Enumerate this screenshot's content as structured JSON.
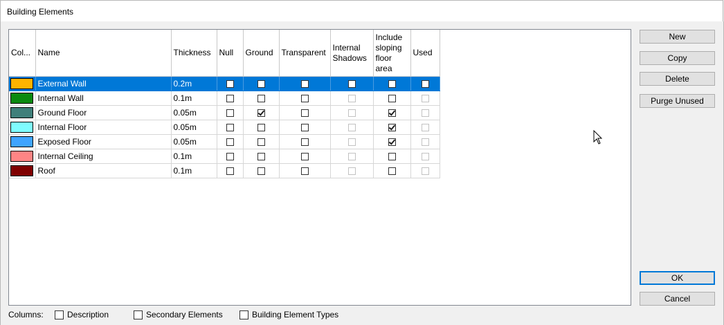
{
  "window": {
    "title": "Building Elements"
  },
  "table": {
    "headers": {
      "color": "Col...",
      "name": "Name",
      "thickness": "Thickness",
      "null": "Null",
      "ground": "Ground",
      "transparent": "Transparent",
      "internal_shadows": "Internal Shadows",
      "include_sloping": "Include sloping floor area",
      "used": "Used"
    },
    "rows": [
      {
        "color": "#ffb300",
        "name": "External Wall",
        "thickness": "0.2m",
        "null": false,
        "ground": false,
        "transparent": false,
        "internal_shadows": false,
        "include_sloping": false,
        "used": false,
        "selected": true
      },
      {
        "color": "#0a8a10",
        "name": "Internal Wall",
        "thickness": "0.1m",
        "null": false,
        "ground": false,
        "transparent": false,
        "internal_shadows": false,
        "include_sloping": false,
        "used": false,
        "selected": false
      },
      {
        "color": "#3f7f7a",
        "name": "Ground Floor",
        "thickness": "0.05m",
        "null": false,
        "ground": true,
        "transparent": false,
        "internal_shadows": false,
        "include_sloping": true,
        "used": false,
        "selected": false
      },
      {
        "color": "#7ffcff",
        "name": "Internal Floor",
        "thickness": "0.05m",
        "null": false,
        "ground": false,
        "transparent": false,
        "internal_shadows": false,
        "include_sloping": true,
        "used": false,
        "selected": false
      },
      {
        "color": "#3fa4ff",
        "name": "Exposed Floor",
        "thickness": "0.05m",
        "null": false,
        "ground": false,
        "transparent": false,
        "internal_shadows": false,
        "include_sloping": true,
        "used": false,
        "selected": false
      },
      {
        "color": "#ff8585",
        "name": "Internal Ceiling",
        "thickness": "0.1m",
        "null": false,
        "ground": false,
        "transparent": false,
        "internal_shadows": false,
        "include_sloping": false,
        "used": false,
        "selected": false
      },
      {
        "color": "#7f0000",
        "name": "Roof",
        "thickness": "0.1m",
        "null": false,
        "ground": false,
        "transparent": false,
        "internal_shadows": false,
        "include_sloping": false,
        "used": false,
        "selected": false
      }
    ]
  },
  "buttons": {
    "new": "New",
    "copy": "Copy",
    "delete": "Delete",
    "purge_unused": "Purge Unused",
    "ok": "OK",
    "cancel": "Cancel"
  },
  "columns_bar": {
    "label": "Columns:",
    "options": [
      {
        "label": "Description",
        "checked": false
      },
      {
        "label": "Secondary Elements",
        "checked": false
      },
      {
        "label": "Building Element Types",
        "checked": false
      }
    ]
  },
  "icons": {
    "cursor": "mouse-pointer-icon"
  }
}
